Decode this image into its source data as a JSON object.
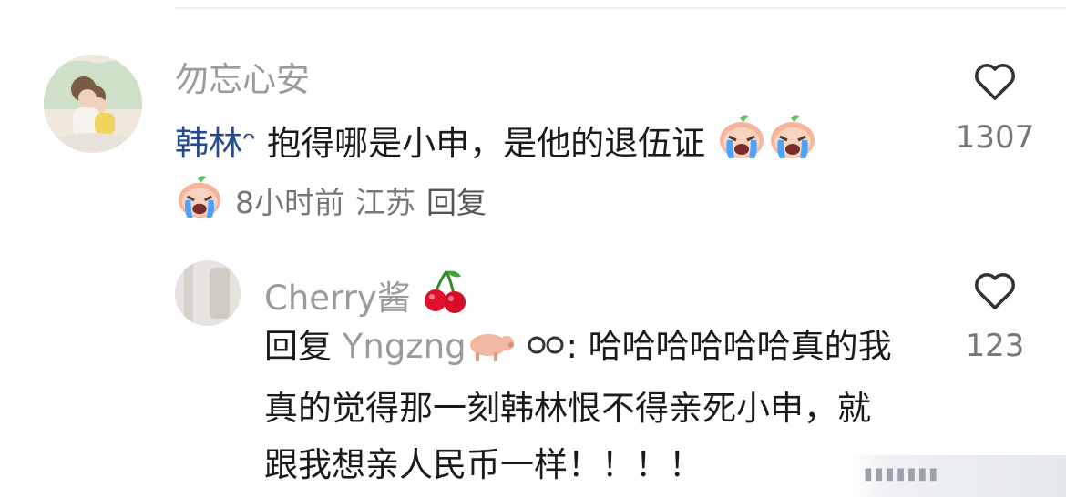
{
  "comment1": {
    "username": "勿忘心安",
    "mention": "韩林ᵔ",
    "text": " 抱得哪是小申，是他的退伍证",
    "emoji_names": [
      "crying-peach-emoji",
      "crying-peach-emoji"
    ],
    "meta": {
      "emoji": "crying-peach-emoji",
      "time": "8小时前",
      "location": "江苏",
      "reply": "回复"
    },
    "like_count": "1307"
  },
  "comment2": {
    "username": "Cherry酱",
    "username_emoji": "cherry-emoji",
    "reply_label": "回复",
    "reply_target": "Yngzng",
    "reply_target_emojis": [
      "pig-emoji",
      "eyes-emoji"
    ],
    "text": "哈哈哈哈哈哈真的我真的觉得那一刻韩林恨不得亲死小申，就跟我想亲人民币一样！！！！",
    "like_count": "123"
  },
  "colors": {
    "mention": "#264b8c",
    "meta": "#777777",
    "name": "#9b9b9b"
  }
}
